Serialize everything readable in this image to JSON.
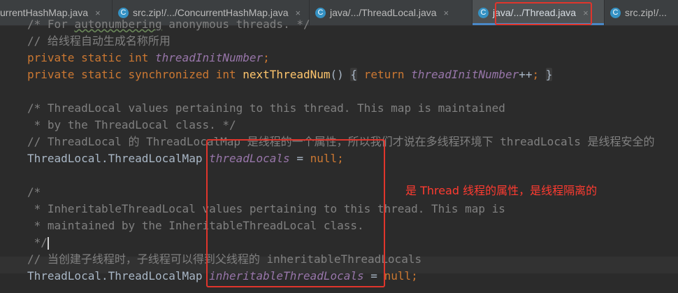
{
  "tabs": [
    {
      "label": "urrentHashMap.java",
      "close": "×",
      "icon": null,
      "active": false
    },
    {
      "label": "src.zip!/.../ConcurrentHashMap.java",
      "close": "×",
      "icon": "C",
      "active": false
    },
    {
      "label": "java/.../ThreadLocal.java",
      "close": "×",
      "icon": "C",
      "active": false
    },
    {
      "label": "java/.../Thread.java",
      "close": "×",
      "icon": "C",
      "active": true
    },
    {
      "label": "src.zip!/...",
      "close": "",
      "icon": "C",
      "active": false
    }
  ],
  "code": {
    "l0": {
      "pre": "/* For ",
      "u": "autonumbering",
      "post": " anonymous threads. */"
    },
    "l1": "// 给线程自动生成名称所用",
    "l2": {
      "kw": "private static int",
      "field": "threadInitNumber",
      "end": ";"
    },
    "l3": {
      "kw1": "private static synchronized int",
      "method": "nextThreadNum",
      "paren": "()",
      "ob": "{",
      "kw2": "return",
      "field": "threadInitNumber",
      "op": "++",
      "semi": ";",
      "cb": "}"
    },
    "l5": "/* ThreadLocal values pertaining to this thread. This map is maintained",
    "l6": " * by the ThreadLocal class. */",
    "l7": "// ThreadLocal 的 ThreadLocalMap 是线程的一个属性，所以我们才说在多线程环境下 threadLocals 是线程安全的",
    "l8": {
      "type": "ThreadLocal.ThreadLocalMap",
      "field": "threadLocals",
      "eq": " = ",
      "kw": "null",
      "end": ";"
    },
    "l10": "/*",
    "l11": " * InheritableThreadLocal values pertaining to this thread. This map is",
    "l12": " * maintained by the InheritableThreadLocal class.",
    "l13": " */",
    "l14": "// 当创建子线程时，子线程可以得到父线程的 inheritableThreadLocals",
    "l15": {
      "type": "ThreadLocal.ThreadLocalMap",
      "field": "inheritableThreadLocals",
      "eq": " = ",
      "kw": "null",
      "end": ";"
    }
  },
  "annotation": "是 Thread 线程的属性，是线程隔离的",
  "colors": {
    "highlight": "#e0352c",
    "keyword": "#cc7832",
    "comment": "#808080",
    "field": "#9876aa",
    "method": "#ffc66d"
  }
}
